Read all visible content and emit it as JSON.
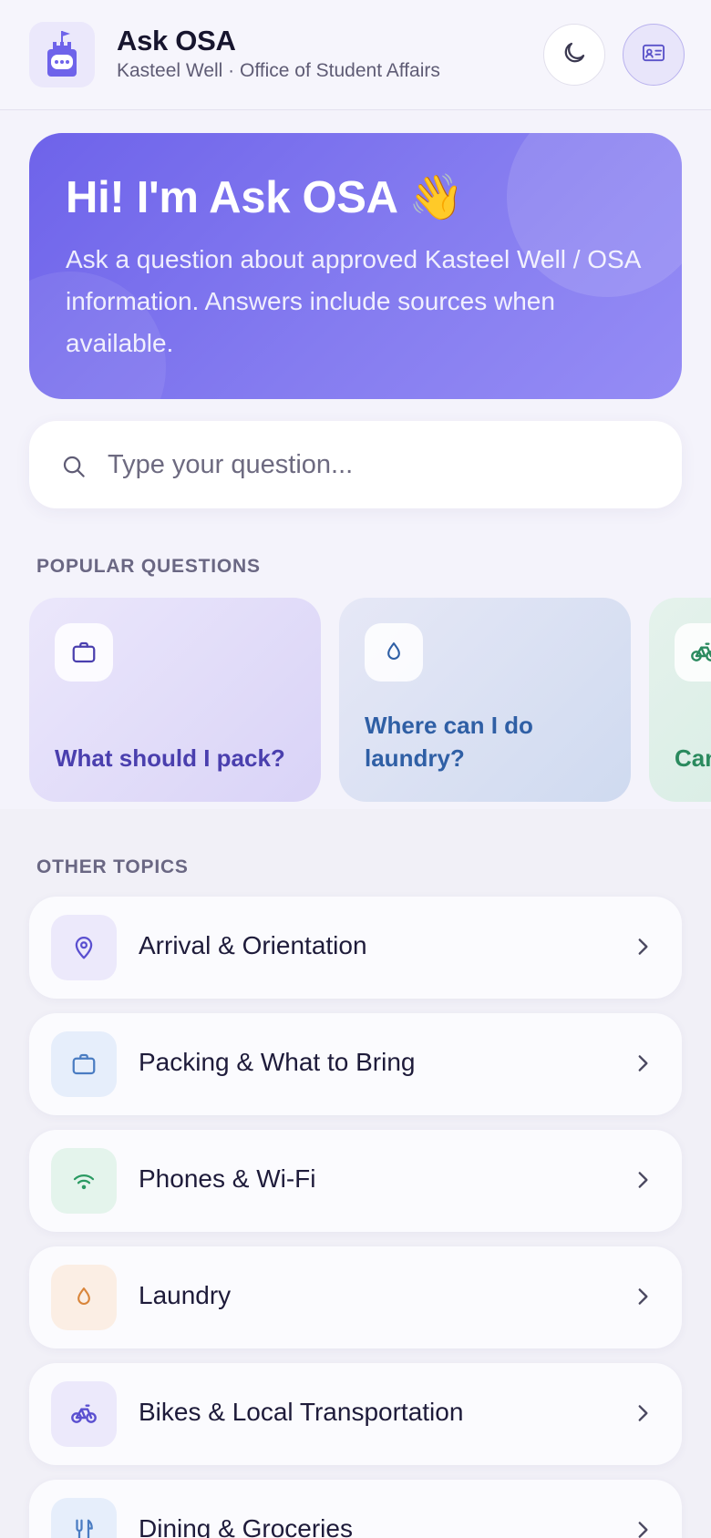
{
  "header": {
    "title": "Ask OSA",
    "subtitle": "Kasteel Well · Office of Student Affairs",
    "logo_icon": "castle-chat-icon",
    "theme_toggle_icon": "moon-icon",
    "id_card_icon": "id-card-icon"
  },
  "hero": {
    "title": "Hi! I'm Ask OSA 👋",
    "text": "Ask a question about approved Kasteel Well / OSA information. Answers include sources when available."
  },
  "search": {
    "placeholder": "Type your question..."
  },
  "popular": {
    "label": "POPULAR QUESTIONS",
    "items": [
      {
        "text": "What should I pack?",
        "icon": "briefcase-icon"
      },
      {
        "text": "Where can I do laundry?",
        "icon": "droplet-icon"
      },
      {
        "text": "Can",
        "icon": "bike-icon"
      }
    ]
  },
  "topics": {
    "label": "OTHER TOPICS",
    "items": [
      {
        "label": "Arrival & Orientation",
        "icon": "map-pin-icon"
      },
      {
        "label": "Packing & What to Bring",
        "icon": "briefcase-icon"
      },
      {
        "label": "Phones & Wi-Fi",
        "icon": "wifi-icon"
      },
      {
        "label": "Laundry",
        "icon": "droplet-icon"
      },
      {
        "label": "Bikes & Local Transportation",
        "icon": "bike-icon"
      },
      {
        "label": "Dining & Groceries",
        "icon": "utensils-icon"
      }
    ]
  },
  "colors": {
    "accent": "#6e63ea",
    "background": "#f4f3fb"
  }
}
